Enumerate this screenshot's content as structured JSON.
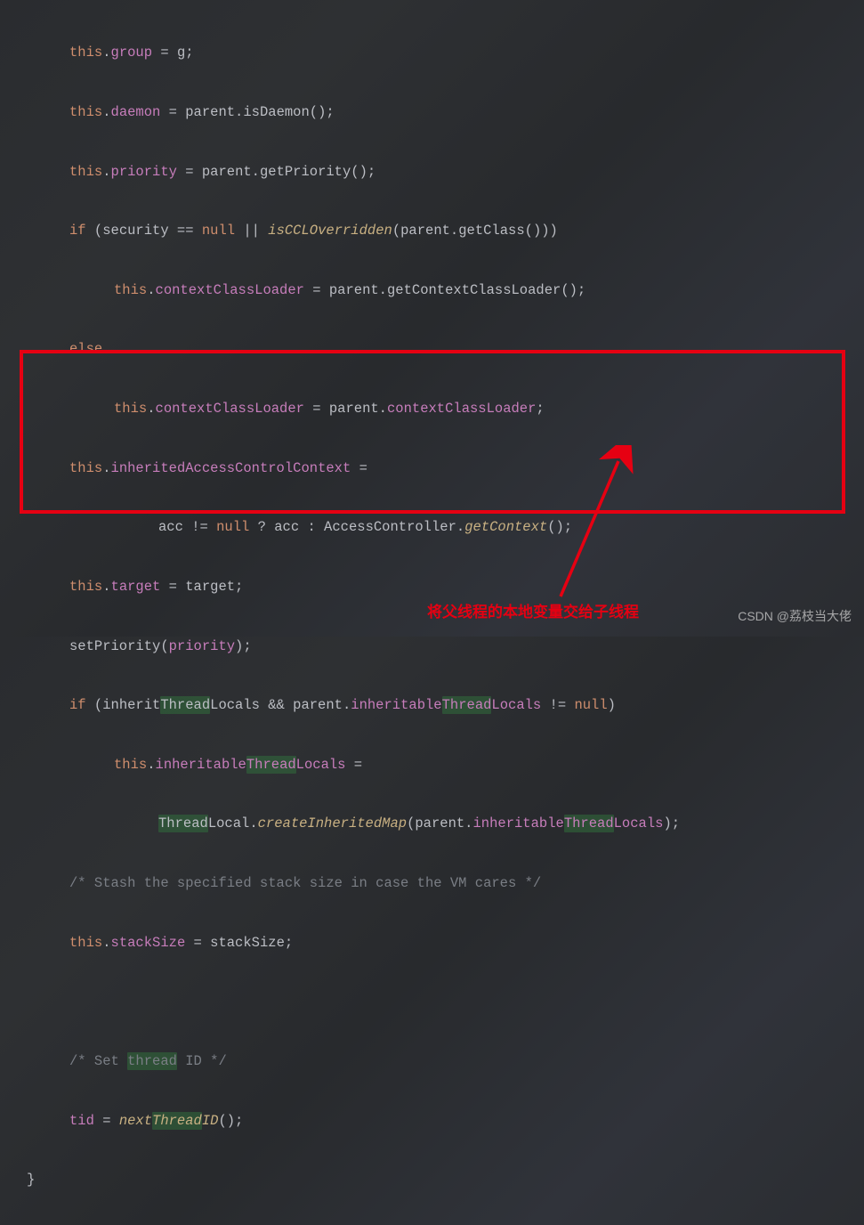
{
  "code": {
    "l1_a": "this",
    "l1_b": ".",
    "l1_c": "group",
    "l1_d": " = g;",
    "l2_a": "this",
    "l2_b": ".",
    "l2_c": "daemon",
    "l2_d": " = parent.isDaemon();",
    "l3_a": "this",
    "l3_b": ".",
    "l3_c": "priority",
    "l3_d": " = parent.getPriority();",
    "l4_a": "if",
    "l4_b": " (security == ",
    "l4_c": "null",
    "l4_d": " || ",
    "l4_e": "isCCLOverridden",
    "l4_f": "(parent.getClass()))",
    "l5_a": "this",
    "l5_b": ".",
    "l5_c": "contextClassLoader",
    "l5_d": " = parent.getContextClassLoader();",
    "l6_a": "else",
    "l7_a": "this",
    "l7_b": ".",
    "l7_c": "contextClassLoader",
    "l7_d": " = parent.",
    "l7_e": "contextClassLoader",
    "l7_f": ";",
    "l8_a": "this",
    "l8_b": ".",
    "l8_c": "inheritedAccessControlContext",
    "l8_d": " =",
    "l9_a": "acc != ",
    "l9_b": "null",
    "l9_c": " ? acc : AccessController.",
    "l9_d": "getContext",
    "l9_e": "();",
    "l10_a": "this",
    "l10_b": ".",
    "l10_c": "target",
    "l10_d": " = target;",
    "l11_a": "setPriority(",
    "l11_b": "priority",
    "l11_c": ");",
    "l12_a": "if",
    "l12_b": " (inherit",
    "l12_hi1": "Thread",
    "l12_c": "Locals && parent.",
    "l12_d": "inheritable",
    "l12_hi2": "Thread",
    "l12_e": "Locals",
    "l12_f": " != ",
    "l12_g": "null",
    "l12_h": ")",
    "l13_a": "this",
    "l13_b": ".",
    "l13_c": "inheritable",
    "l13_hi": "Thread",
    "l13_d": "Locals",
    "l13_e": " =",
    "l14_hi1": "Thread",
    "l14_a": "Local.",
    "l14_b": "createInheritedMap",
    "l14_c": "(parent.",
    "l14_d": "inheritable",
    "l14_hi2": "Thread",
    "l14_e": "Locals",
    "l14_f": ");",
    "l15": "/* Stash the specified stack size in case the VM cares */",
    "l16_a": "this",
    "l16_b": ".",
    "l16_c": "stackSize",
    "l16_d": " = stackSize;",
    "l18": "/* Set ",
    "l18_hi": "thread",
    "l18_b": " ID */",
    "l19_a": "tid",
    "l19_b": " = ",
    "l19_c": "next",
    "l19_hi": "Thread",
    "l19_d": "ID",
    "l19_e": "();",
    "l20": "}"
  },
  "annotation": "将父线程的本地变量交给子线程",
  "watermark": "CSDN @荔枝当大佬"
}
